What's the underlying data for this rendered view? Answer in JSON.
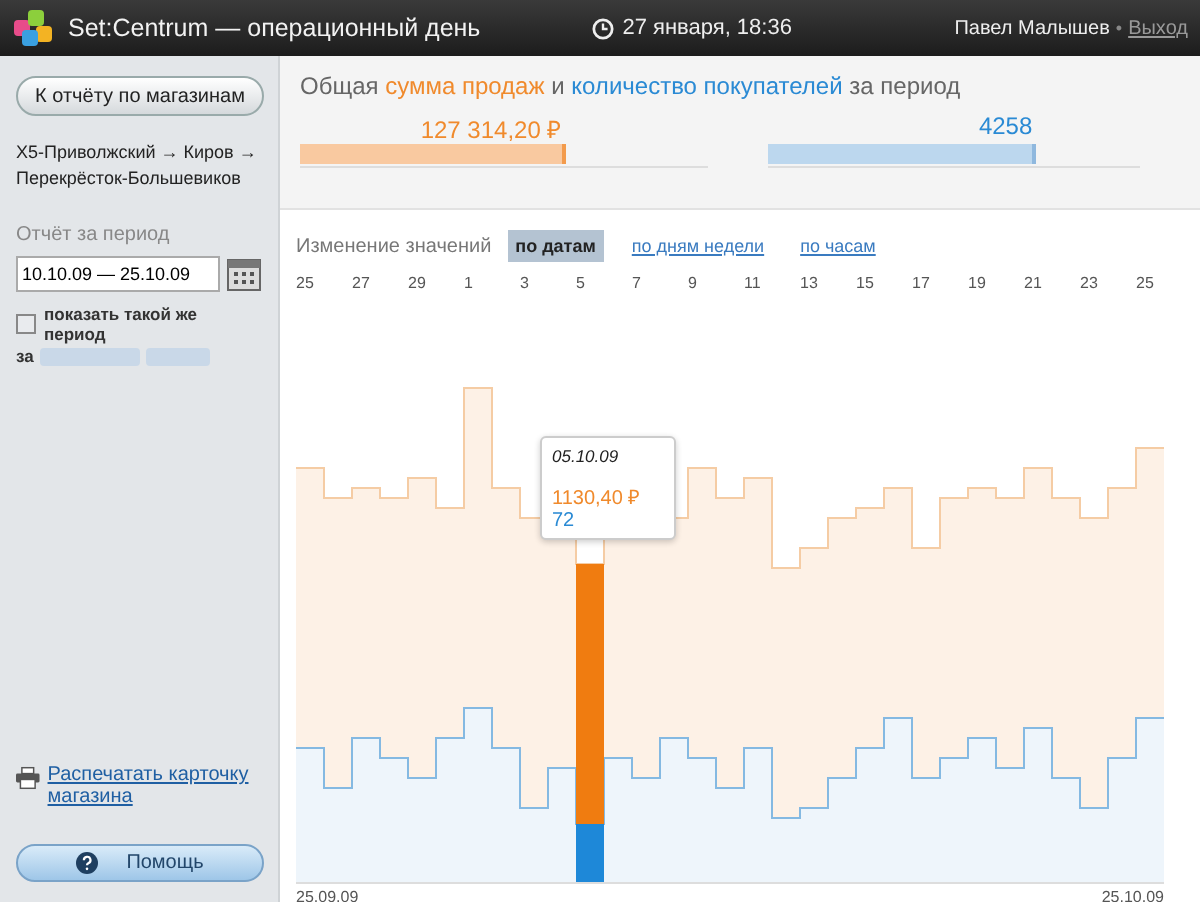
{
  "header": {
    "title": "Set:Centrum — операционный день",
    "datetime": "27 января, 18:36",
    "user": "Павел Малышев",
    "separator": "•",
    "logout": "Выход"
  },
  "sidebar": {
    "back_button": "К отчёту по магазинам",
    "store_path": "X5-Приволжский → Киров → Перекрёсток-Большевиков",
    "period_label": "Отчёт за период",
    "period_value": "10.10.09 — 25.10.09",
    "compare": {
      "label": "показать такой же период",
      "suffix": "за",
      "checked": false
    },
    "print_link": "Распечатать карточку магазина",
    "help_button": "Помощь"
  },
  "summary": {
    "title_parts": [
      {
        "text": "Общая ",
        "kind": "plain"
      },
      {
        "text": "сумма продаж",
        "kind": "sales"
      },
      {
        "text": " и ",
        "kind": "plain"
      },
      {
        "text": "количество покупателей",
        "kind": "customers"
      },
      {
        "text": " за период",
        "kind": "plain"
      }
    ],
    "meters": [
      {
        "kind": "sales",
        "value": "127 314,20 ₽",
        "level": 0.64
      },
      {
        "kind": "customers",
        "value": "4258",
        "level": 0.71
      }
    ]
  },
  "chart": {
    "heading": "Изменение значений",
    "tabs": [
      {
        "label": "по датам",
        "selected": true
      },
      {
        "label": "по дням недели",
        "selected": false
      },
      {
        "label": "по часам",
        "selected": false
      }
    ],
    "day_ticks": [
      "25",
      "27",
      "29",
      "1",
      "3",
      "5",
      "7",
      "9",
      "11",
      "13",
      "15",
      "17",
      "19",
      "21",
      "23",
      "25"
    ],
    "tooltip": {
      "date": "05.10.09",
      "sales": "1130,40 ₽",
      "customers": "72"
    },
    "range_start": "25.09.09",
    "range_end": "25.10.09"
  }
}
